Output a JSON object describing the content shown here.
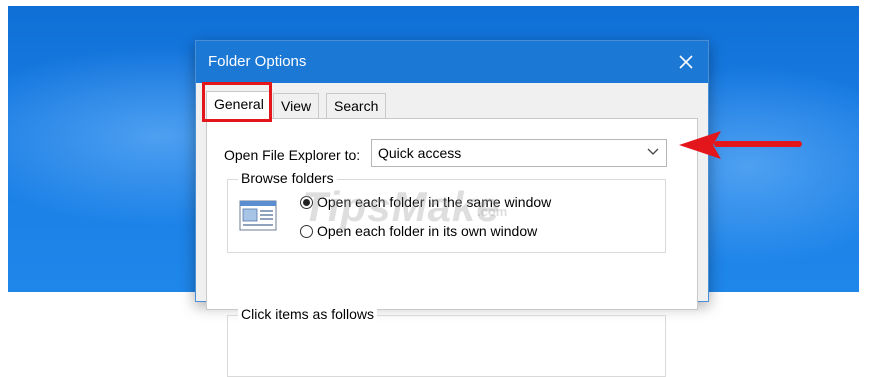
{
  "window": {
    "title": "Folder Options",
    "close_icon": "close-icon"
  },
  "tabs": [
    {
      "label": "General",
      "active": true
    },
    {
      "label": "View",
      "active": false
    },
    {
      "label": "Search",
      "active": false
    }
  ],
  "general": {
    "open_explorer_label": "Open File Explorer to:",
    "open_explorer_value": "Quick access",
    "browse_folders": {
      "title": "Browse folders",
      "options": [
        {
          "label": "Open each folder in the same window",
          "checked": true
        },
        {
          "label": "Open each folder in its own window",
          "checked": false
        }
      ]
    },
    "click_items": {
      "title": "Click items as follows"
    }
  },
  "watermark": {
    "text": "TipsMake",
    "suffix": ".com"
  },
  "annotations": {
    "highlight_color": "#e3161b",
    "arrow_color": "#e3161b"
  },
  "colors": {
    "titlebar": "#1b78d4",
    "desktop": "#1a7de4"
  }
}
